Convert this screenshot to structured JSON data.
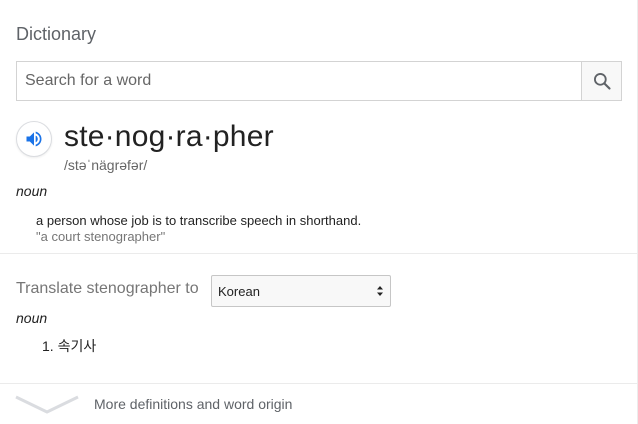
{
  "dictionary": {
    "title": "Dictionary",
    "search": {
      "placeholder": "Search for a word",
      "value": ""
    },
    "entry": {
      "word": "ste·nog·ra·pher",
      "phonetic": "/stəˈnägrəfər/",
      "part_of_speech": "noun",
      "definition": "a person whose job is to transcribe speech in shorthand.",
      "example": "\"a court stenographer\""
    },
    "translate": {
      "label": "Translate stenographer to",
      "selected_language": "Korean",
      "part_of_speech": "noun",
      "items": [
        "1. 속기사"
      ]
    },
    "more_link": "More definitions and word origin"
  },
  "icons": {
    "search": "search-icon",
    "speaker": "speaker-icon",
    "more": "chevron-down-icon",
    "select": "select-arrows-icon"
  },
  "colors": {
    "speaker_blue": "#1a73e8",
    "muted_text": "#767676",
    "border": "#d3d3d3"
  }
}
